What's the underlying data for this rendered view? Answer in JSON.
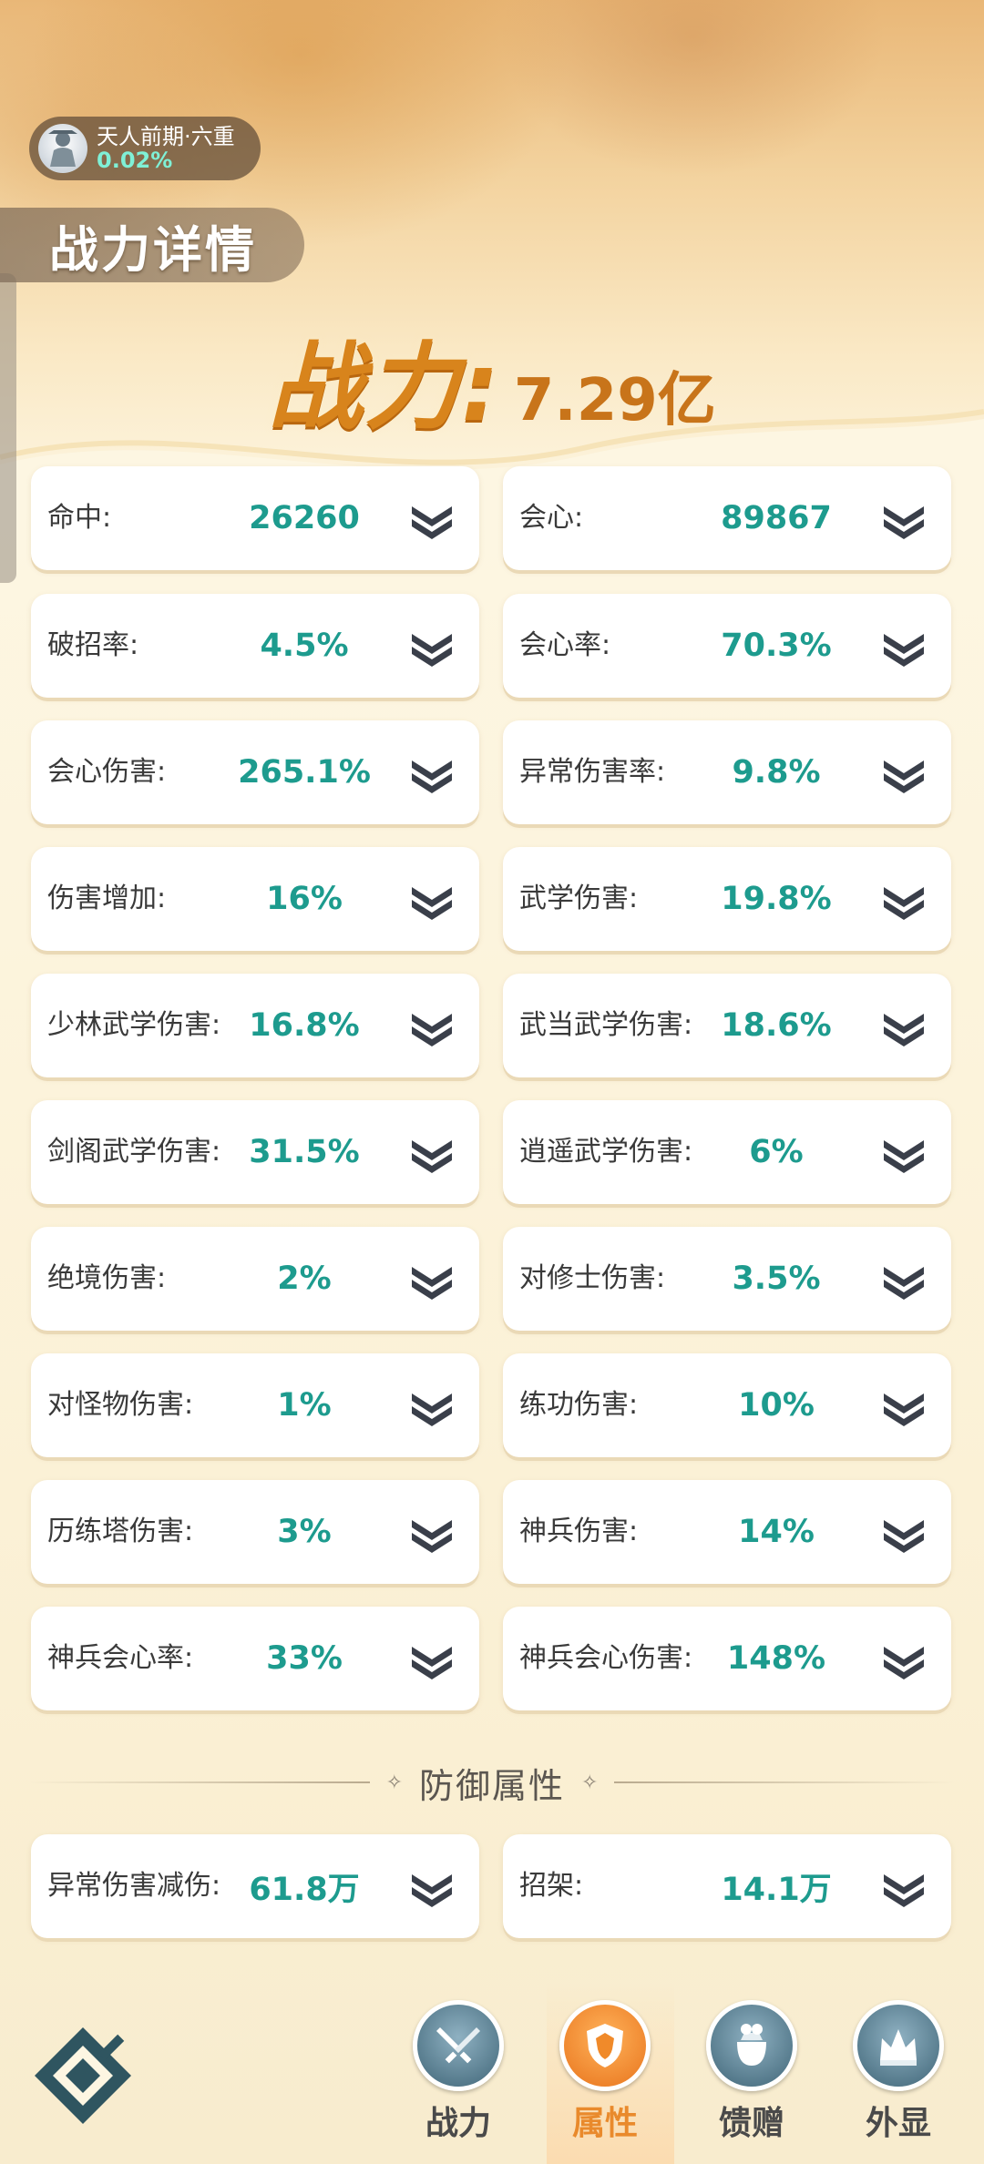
{
  "rank": {
    "name": "天人前期·六重",
    "percent": "0.02%"
  },
  "page_title": "战力详情",
  "power": {
    "label": "战力:",
    "value": "7.29亿"
  },
  "stats": [
    {
      "label": "命中:",
      "value": "26260"
    },
    {
      "label": "会心:",
      "value": "89867"
    },
    {
      "label": "破招率:",
      "value": "4.5%"
    },
    {
      "label": "会心率:",
      "value": "70.3%"
    },
    {
      "label": "会心伤害:",
      "value": "265.1%"
    },
    {
      "label": "异常伤害率:",
      "value": "9.8%"
    },
    {
      "label": "伤害增加:",
      "value": "16%"
    },
    {
      "label": "武学伤害:",
      "value": "19.8%"
    },
    {
      "label": "少林武学伤害:",
      "value": "16.8%"
    },
    {
      "label": "武当武学伤害:",
      "value": "18.6%"
    },
    {
      "label": "剑阁武学伤害:",
      "value": "31.5%"
    },
    {
      "label": "逍遥武学伤害:",
      "value": "6%"
    },
    {
      "label": "绝境伤害:",
      "value": "2%"
    },
    {
      "label": "对修士伤害:",
      "value": "3.5%"
    },
    {
      "label": "对怪物伤害:",
      "value": "1%"
    },
    {
      "label": "练功伤害:",
      "value": "10%"
    },
    {
      "label": "历练塔伤害:",
      "value": "3%"
    },
    {
      "label": "神兵伤害:",
      "value": "14%"
    },
    {
      "label": "神兵会心率:",
      "value": "33%"
    },
    {
      "label": "神兵会心伤害:",
      "value": "148%"
    }
  ],
  "defense_section": {
    "title": "防御属性",
    "stats": [
      {
        "label": "异常伤害减伤:",
        "value": "61.8万"
      },
      {
        "label": "招架:",
        "value": "14.1万"
      }
    ]
  },
  "nav": {
    "items": [
      {
        "label": "战力",
        "icon": "swords-icon"
      },
      {
        "label": "属性",
        "icon": "shield-icon"
      },
      {
        "label": "馈赠",
        "icon": "gift-bag-icon"
      },
      {
        "label": "外显",
        "icon": "crown-icon"
      }
    ],
    "active_index": 1
  },
  "colors": {
    "value_teal": "#1d9b8e",
    "power_orange": "#d8841c",
    "active_nav": "#e98a2c"
  }
}
